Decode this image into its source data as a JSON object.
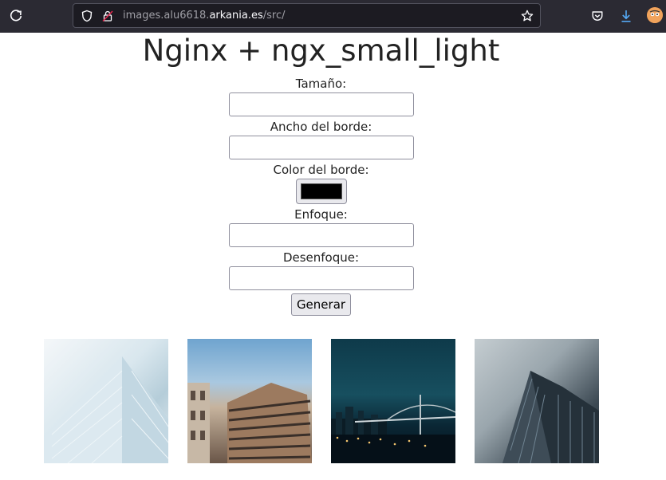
{
  "browser": {
    "url_prefix": "images.alu6618.",
    "url_domain": "arkania.es",
    "url_path": "/src/"
  },
  "page": {
    "title": "Nginx + ngx_small_light",
    "form": {
      "size_label": "Tamaño:",
      "size_value": "",
      "border_width_label": "Ancho del borde:",
      "border_width_value": "",
      "border_color_label": "Color del borde:",
      "border_color_value": "#000000",
      "sharpen_label": "Enfoque:",
      "sharpen_value": "",
      "blur_label": "Desenfoque:",
      "blur_value": "",
      "submit_label": "Generar"
    }
  },
  "gallery": {
    "images": [
      "building-facade-glass",
      "buildings-street-sky",
      "bridge-night-city",
      "skyscraper-cloudy"
    ]
  }
}
